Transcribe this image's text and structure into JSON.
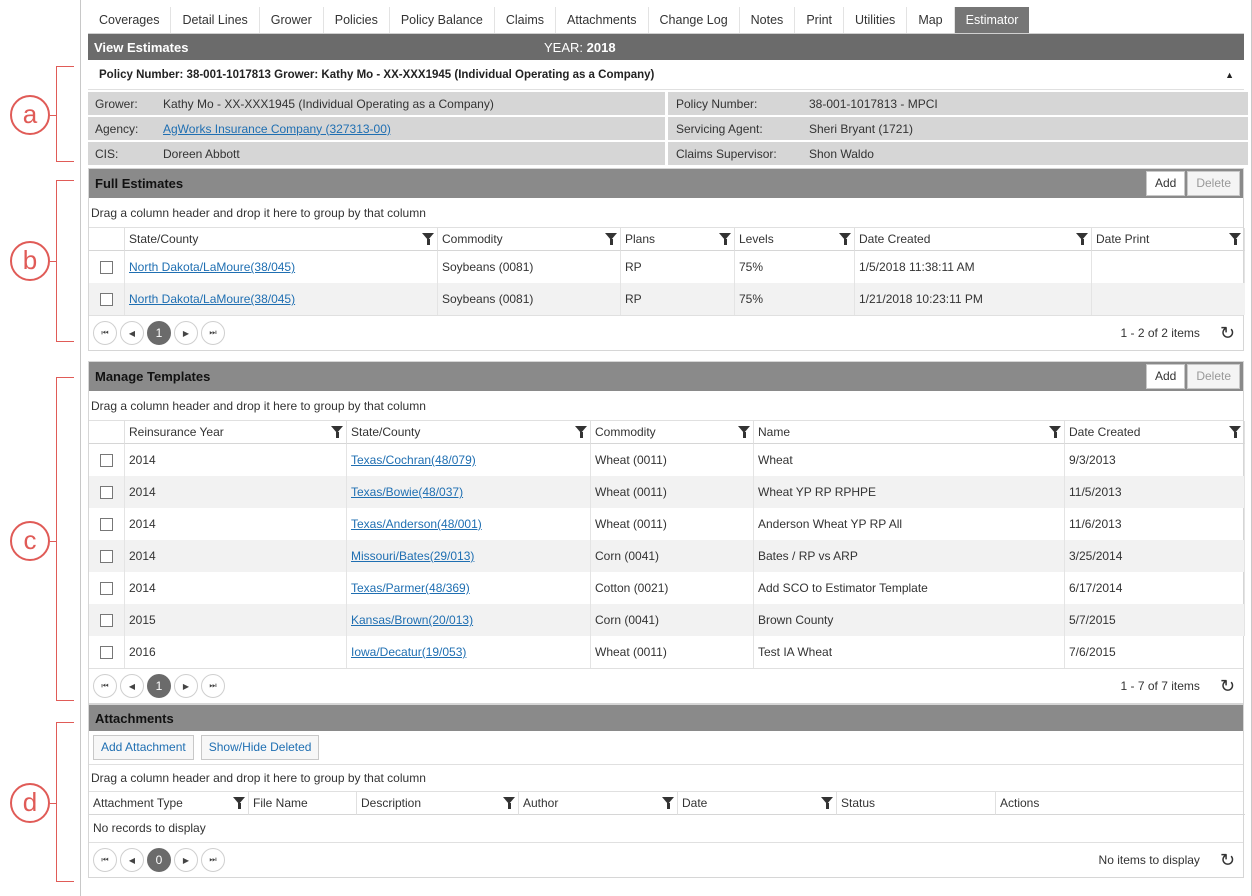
{
  "callouts": [
    "a",
    "b",
    "c",
    "d"
  ],
  "tabs": [
    "Coverages",
    "Detail Lines",
    "Grower",
    "Policies",
    "Policy Balance",
    "Claims",
    "Attachments",
    "Change Log",
    "Notes",
    "Print",
    "Utilities",
    "Map",
    "Estimator"
  ],
  "active_tab": "Estimator",
  "view": {
    "title": "View Estimates",
    "year_label": "YEAR:",
    "year": "2018"
  },
  "policy_header": {
    "text": "Policy Number: 38-001-1017813 Grower: Kathy Mo - XX-XXX1945 (Individual Operating as a Company)"
  },
  "info": {
    "grower_label": "Grower:",
    "grower": "Kathy Mo - XX-XXX1945 (Individual Operating as a Company)",
    "policy_label": "Policy Number:",
    "policy": "38-001-1017813 - MPCI",
    "agency_label": "Agency:",
    "agency": "AgWorks Insurance Company (327313-00)",
    "agent_label": "Servicing Agent:",
    "agent": "Sheri Bryant (1721)",
    "cis_label": "CIS:",
    "cis": "Doreen Abbott",
    "supervisor_label": "Claims Supervisor:",
    "supervisor": "Shon Waldo"
  },
  "common": {
    "add": "Add",
    "delete": "Delete",
    "group_hint": "Drag a column header and drop it here to group by that column"
  },
  "full_estimates": {
    "title": "Full Estimates",
    "columns": [
      "State/County",
      "Commodity",
      "Plans",
      "Levels",
      "Date Created",
      "Date Print"
    ],
    "rows": [
      {
        "state_county": "North Dakota/LaMoure(38/045)",
        "commodity": "Soybeans (0081)",
        "plans": "RP",
        "levels": "75%",
        "date_created": "1/5/2018 11:38:11 AM",
        "date_print": ""
      },
      {
        "state_county": "North Dakota/LaMoure(38/045)",
        "commodity": "Soybeans (0081)",
        "plans": "RP",
        "levels": "75%",
        "date_created": "1/21/2018 10:23:11 PM",
        "date_print": ""
      }
    ],
    "page": "1",
    "summary": "1 - 2 of 2 items"
  },
  "templates": {
    "title": "Manage Templates",
    "columns": [
      "Reinsurance Year",
      "State/County",
      "Commodity",
      "Name",
      "Date Created"
    ],
    "rows": [
      {
        "year": "2014",
        "state_county": "Texas/Cochran(48/079)",
        "commodity": "Wheat (0011)",
        "name": "Wheat",
        "date": "9/3/2013"
      },
      {
        "year": "2014",
        "state_county": "Texas/Bowie(48/037)",
        "commodity": "Wheat (0011)",
        "name": "Wheat YP RP RPHPE",
        "date": "11/5/2013"
      },
      {
        "year": "2014",
        "state_county": "Texas/Anderson(48/001)",
        "commodity": "Wheat (0011)",
        "name": "Anderson Wheat YP RP All",
        "date": "11/6/2013"
      },
      {
        "year": "2014",
        "state_county": "Missouri/Bates(29/013)",
        "commodity": "Corn (0041)",
        "name": "Bates / RP vs ARP",
        "date": "3/25/2014"
      },
      {
        "year": "2014",
        "state_county": "Texas/Parmer(48/369)",
        "commodity": "Cotton (0021)",
        "name": "Add SCO to Estimator Template",
        "date": "6/17/2014"
      },
      {
        "year": "2015",
        "state_county": "Kansas/Brown(20/013)",
        "commodity": "Corn (0041)",
        "name": "Brown County",
        "date": "5/7/2015"
      },
      {
        "year": "2016",
        "state_county": "Iowa/Decatur(19/053)",
        "commodity": "Wheat (0011)",
        "name": "Test IA Wheat",
        "date": "7/6/2015"
      }
    ],
    "page": "1",
    "summary": "1 - 7 of 7 items"
  },
  "attachments": {
    "title": "Attachments",
    "add_label": "Add Attachment",
    "toggle_label": "Show/Hide Deleted",
    "columns": [
      "Attachment Type",
      "File Name",
      "Description",
      "Author",
      "Date",
      "Status",
      "Actions"
    ],
    "empty": "No records to display",
    "page": "0",
    "summary": "No items to display"
  },
  "icons": {
    "filter": "filter-icon",
    "refresh": "refresh-icon",
    "collapse": "triangle-up-icon",
    "first": "first-page-icon",
    "prev": "prev-page-icon",
    "next": "next-page-icon",
    "last": "last-page-icon"
  },
  "colors": {
    "title_bar": "#6b6b6b",
    "panel_header": "#8a8a8a",
    "info_bg": "#d6d6d6",
    "link": "#1f6fb2",
    "callout": "#e05b57",
    "active_tab": "#767676"
  }
}
